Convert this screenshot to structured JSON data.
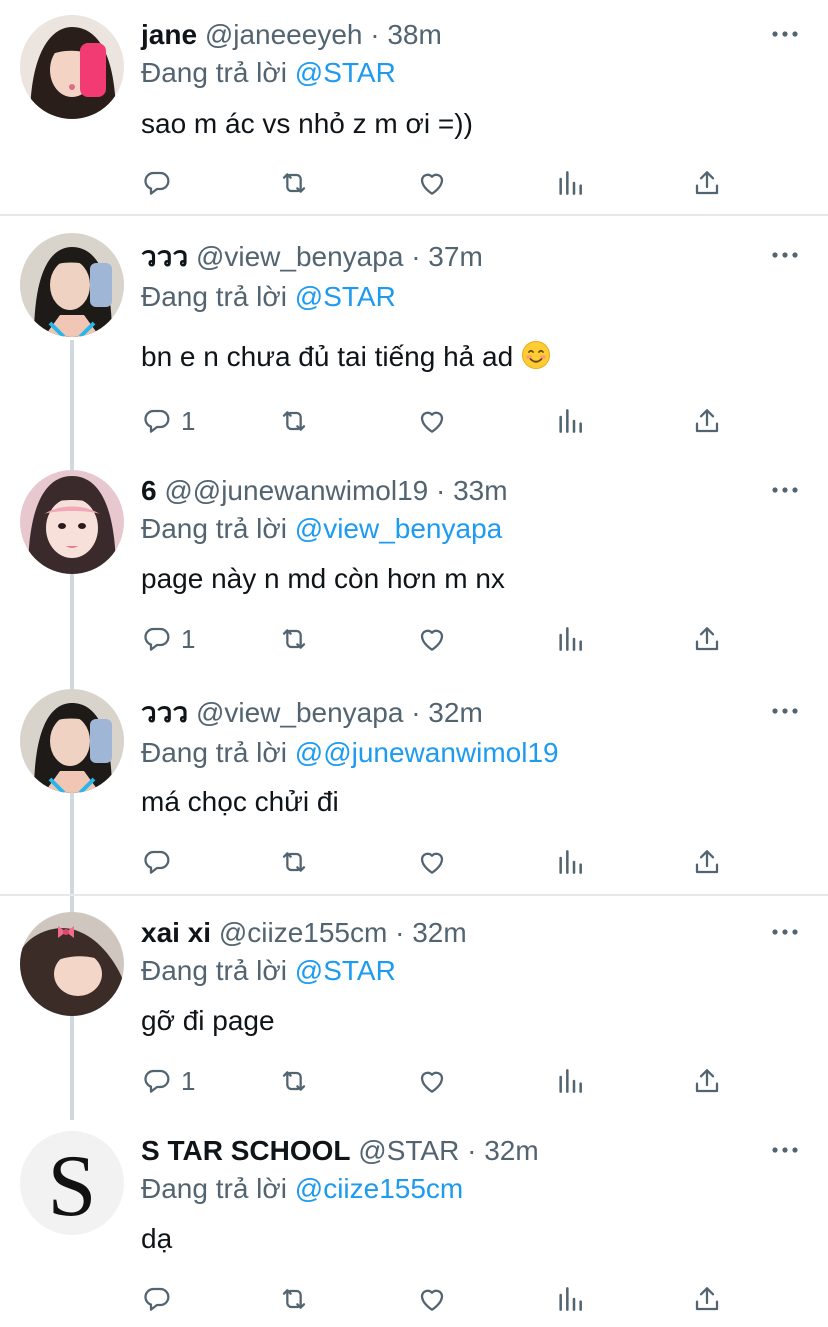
{
  "reply_prefix": "Đang trả lời",
  "tweets": [
    {
      "name": "jane",
      "handle": "@janeeeyeh",
      "dot": "·",
      "time": "38m",
      "reply_to": "@STAR",
      "text": "sao m ác vs nhỏ z m ơi =))",
      "reply_count": "",
      "avatar": "avatar-jane"
    },
    {
      "name": "ววว",
      "handle": "@view_benyapa",
      "dot": "·",
      "time": "37m",
      "reply_to": "@STAR",
      "text": "bn e n chưa đủ tai tiếng hả ad",
      "emoji": "smiling-face-emoji",
      "reply_count": "1",
      "avatar": "avatar-view"
    },
    {
      "name": "6",
      "handle": "@@junewanwimol19",
      "dot": "·",
      "time": "33m",
      "reply_to": "@view_benyapa",
      "text": "page này n md còn hơn m nx",
      "reply_count": "1",
      "avatar": "avatar-june"
    },
    {
      "name": "ววว",
      "handle": "@view_benyapa",
      "dot": "·",
      "time": "32m",
      "reply_to": "@@junewanwimol19",
      "text": "má chọc chửi đi",
      "reply_count": "",
      "avatar": "avatar-view"
    },
    {
      "name": "xai xi",
      "handle": "@ciize155cm",
      "dot": "·",
      "time": "32m",
      "reply_to": "@STAR",
      "text": "gỡ đi page",
      "reply_count": "1",
      "avatar": "avatar-xaixi"
    },
    {
      "name": "S TAR SCHOOL",
      "handle": "@STAR",
      "dot": "·",
      "time": "32m",
      "reply_to": "@ciize155cm",
      "text": "dạ",
      "reply_count": "",
      "avatar": "avatar-star"
    }
  ],
  "colors": {
    "accent": "#1d9bf0",
    "muted": "#536471",
    "text": "#0f1419",
    "separator": "#e6e9ec",
    "thread_line": "#cfd9de"
  },
  "icons": [
    "reply-icon",
    "retweet-icon",
    "like-icon",
    "analytics-icon",
    "share-icon",
    "more-icon"
  ]
}
